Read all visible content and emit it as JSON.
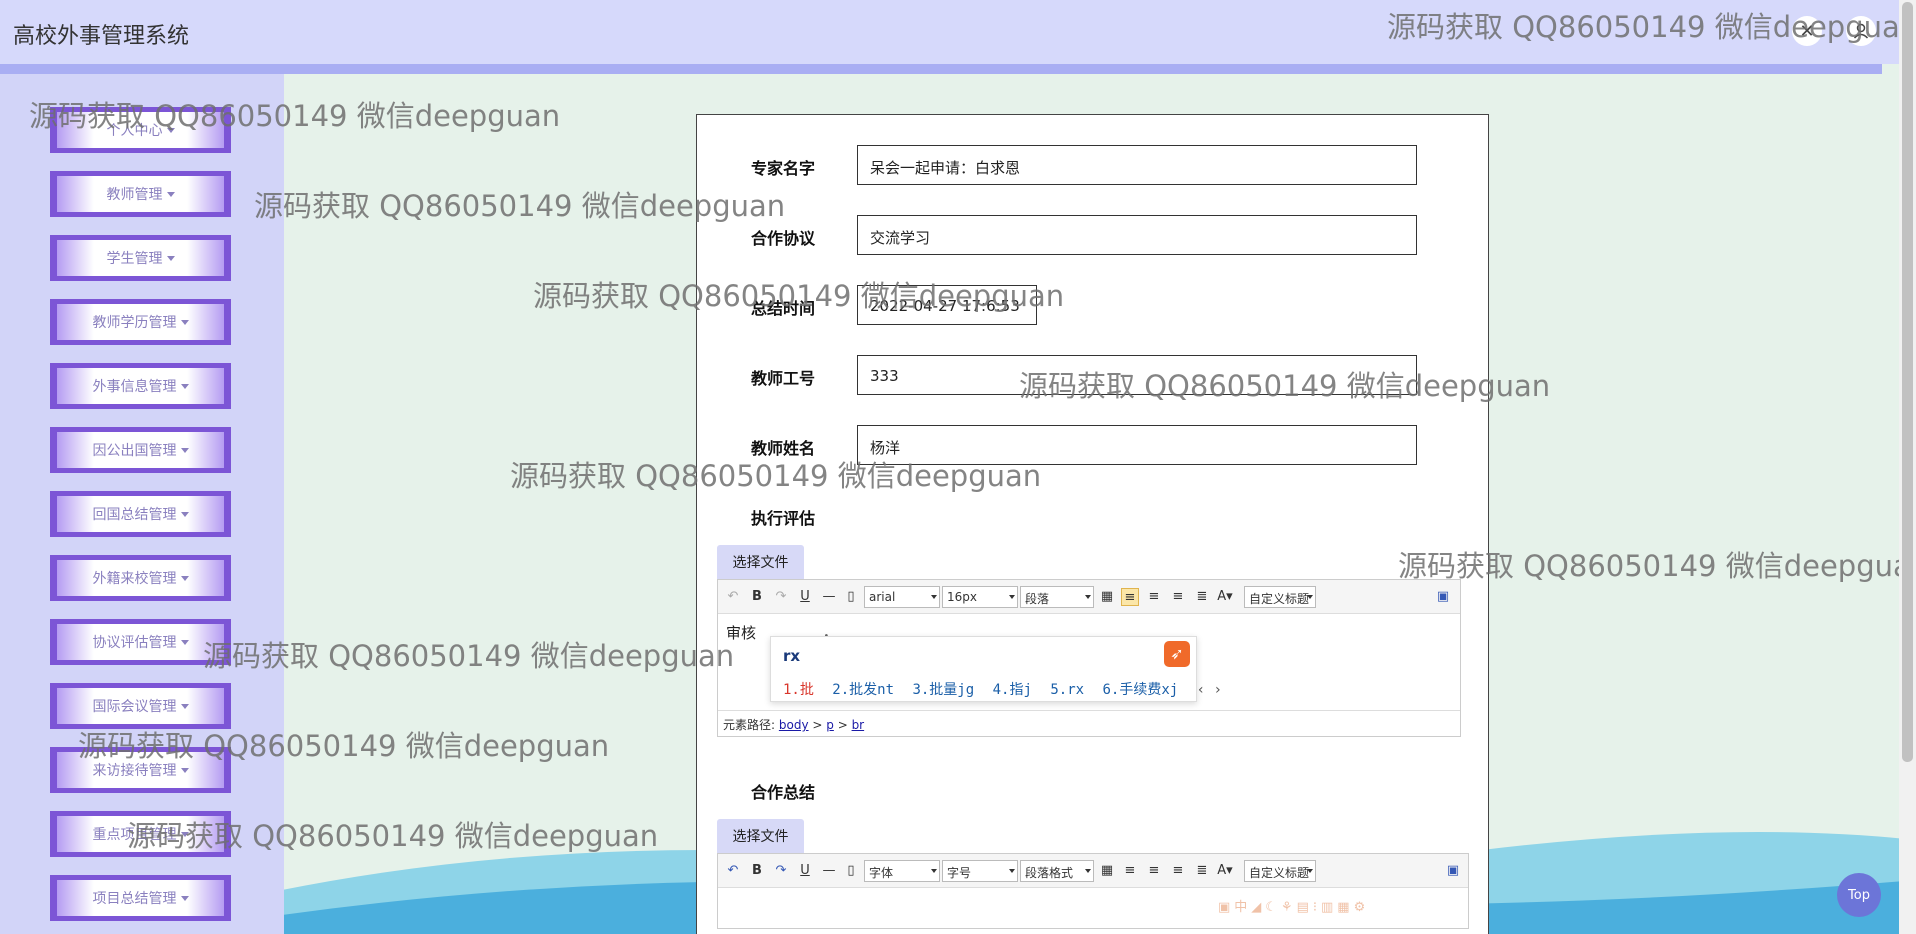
{
  "app": {
    "title": "高校外事管理系统"
  },
  "header": {
    "close_icon": "close-icon",
    "user_icon": "user-icon"
  },
  "sidebar": {
    "items": [
      {
        "label": "个人中心"
      },
      {
        "label": "教师管理"
      },
      {
        "label": "学生管理"
      },
      {
        "label": "教师学历管理"
      },
      {
        "label": "外事信息管理"
      },
      {
        "label": "因公出国管理"
      },
      {
        "label": "回国总结管理"
      },
      {
        "label": "外籍来校管理"
      },
      {
        "label": "协议评估管理"
      },
      {
        "label": "国际会议管理"
      },
      {
        "label": "来访接待管理"
      },
      {
        "label": "重点项目管理"
      },
      {
        "label": "项目总结管理"
      }
    ]
  },
  "form": {
    "fields": [
      {
        "label": "专家名字",
        "value": "呆会一起申请：白求恩"
      },
      {
        "label": "合作协议",
        "value": "交流学习"
      },
      {
        "label": "总结时间",
        "value": "2022-04-27 17:6:53"
      },
      {
        "label": "教师工号",
        "value": "333"
      },
      {
        "label": "教师姓名",
        "value": "杨洋"
      }
    ],
    "eval_label": "执行评估",
    "summary_label": "合作总结",
    "choose_file": "选择文件"
  },
  "editor1": {
    "font": "arial",
    "size": "16px",
    "para": "段落",
    "custom": "自定义标题",
    "content": "审核",
    "path_label": "元素路径:",
    "path": [
      "body",
      "p",
      "br"
    ]
  },
  "editor2": {
    "font": "字体",
    "size": "字号",
    "para": "段落格式",
    "custom": "自定义标题"
  },
  "ime": {
    "input": "rx",
    "candidates": [
      "1.批",
      "2.批发nt",
      "3.批量jg",
      "4.指j",
      "5.rx",
      "6.手续费xj"
    ],
    "nav": "‹ ›"
  },
  "watermark": {
    "text": "源码获取 QQ86050149 微信deepguan",
    "cut1": "源码获取 QQ86050149 微信deepguar",
    "cut2": "源码获取 QQ86050149 微信deepgua"
  },
  "top_button": "Top"
}
